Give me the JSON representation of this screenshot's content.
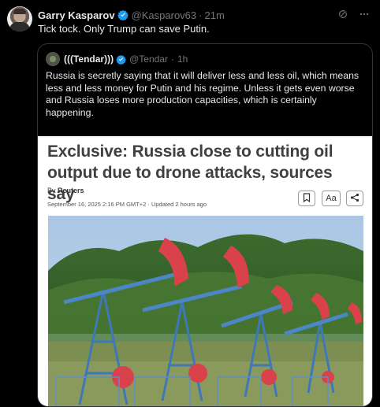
{
  "post": {
    "author_name": "Garry Kasparov",
    "author_handle": "@Kasparov63",
    "separator": "·",
    "time": "21m",
    "text": "Tick tock. Only Trump can save Putin."
  },
  "quoted": {
    "author_name": "(((Tendar)))",
    "author_handle": "@Tendar",
    "separator": "·",
    "time": "1h",
    "text": "Russia is secretly saying that it will deliver less and less oil, which means less and less money for Putin and his regime. Unless it gets even worse and Russia loses more production capacities, which is certainly happening."
  },
  "article": {
    "headline": "Exclusive: Russia close to cutting oil output due to drone attacks, sources say",
    "by_prefix": "By",
    "source": "Reuters",
    "date": "September 16, 2025 2:16 PM GMT+2 · Updated 2 hours ago",
    "font_button_label": "Aa"
  },
  "icons": {
    "verified": "verified-badge-icon",
    "grok": "grok-icon",
    "more": "more-options-icon",
    "bookmark": "bookmark-icon",
    "share": "share-icon"
  },
  "colors": {
    "background": "#000000",
    "text": "#e7e9ea",
    "muted": "#71767b",
    "verified": "#1d9bf0",
    "border": "#2f3336"
  }
}
